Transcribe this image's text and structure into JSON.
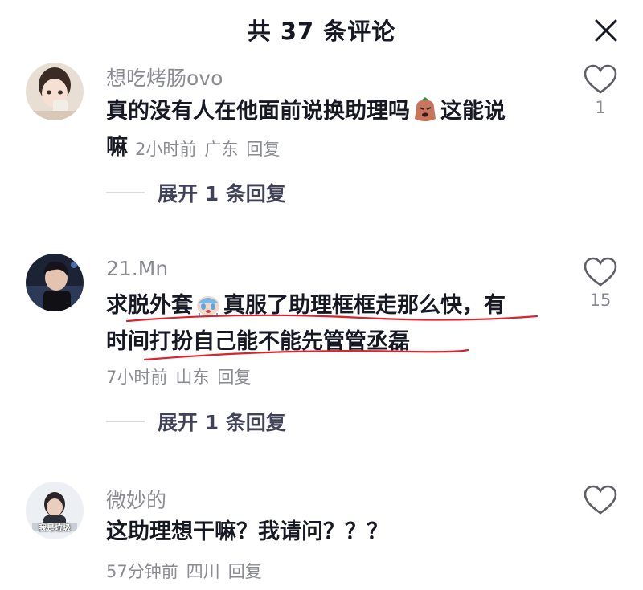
{
  "header": {
    "title": "共 37 条评论"
  },
  "comments": [
    {
      "username": "想吃烤肠ovo",
      "text_before_emoji": "真的没有人在他面前说换助理吗",
      "text_after_emoji": "这能说",
      "text_line2": "嘛",
      "time": "2小时前",
      "location": "广东",
      "reply_label": "回复",
      "like_count": "1",
      "expand_label": "展开 1 条回复",
      "emoji_icon": "angry-sack-emoji"
    },
    {
      "username": "21.Mn",
      "text_before_emoji": "求脱外套",
      "text_after_emoji": "真服了助理框框走那么快，有",
      "text_line2": "时间打扮自己能不能先管管丞磊",
      "time": "7小时前",
      "location": "山东",
      "reply_label": "回复",
      "like_count": "15",
      "expand_label": "展开 1 条回复",
      "emoji_icon": "crying-emoji"
    },
    {
      "username": "微妙的",
      "text": "这助理想干嘛？我请问？？？",
      "time": "57分钟前",
      "location": "四川",
      "reply_label": "回复",
      "like_count": "",
      "avatar_caption": "我是垃圾"
    }
  ],
  "colors": {
    "text": "#161823",
    "secondary": "#8a8b91",
    "underline": "#d9232e"
  }
}
